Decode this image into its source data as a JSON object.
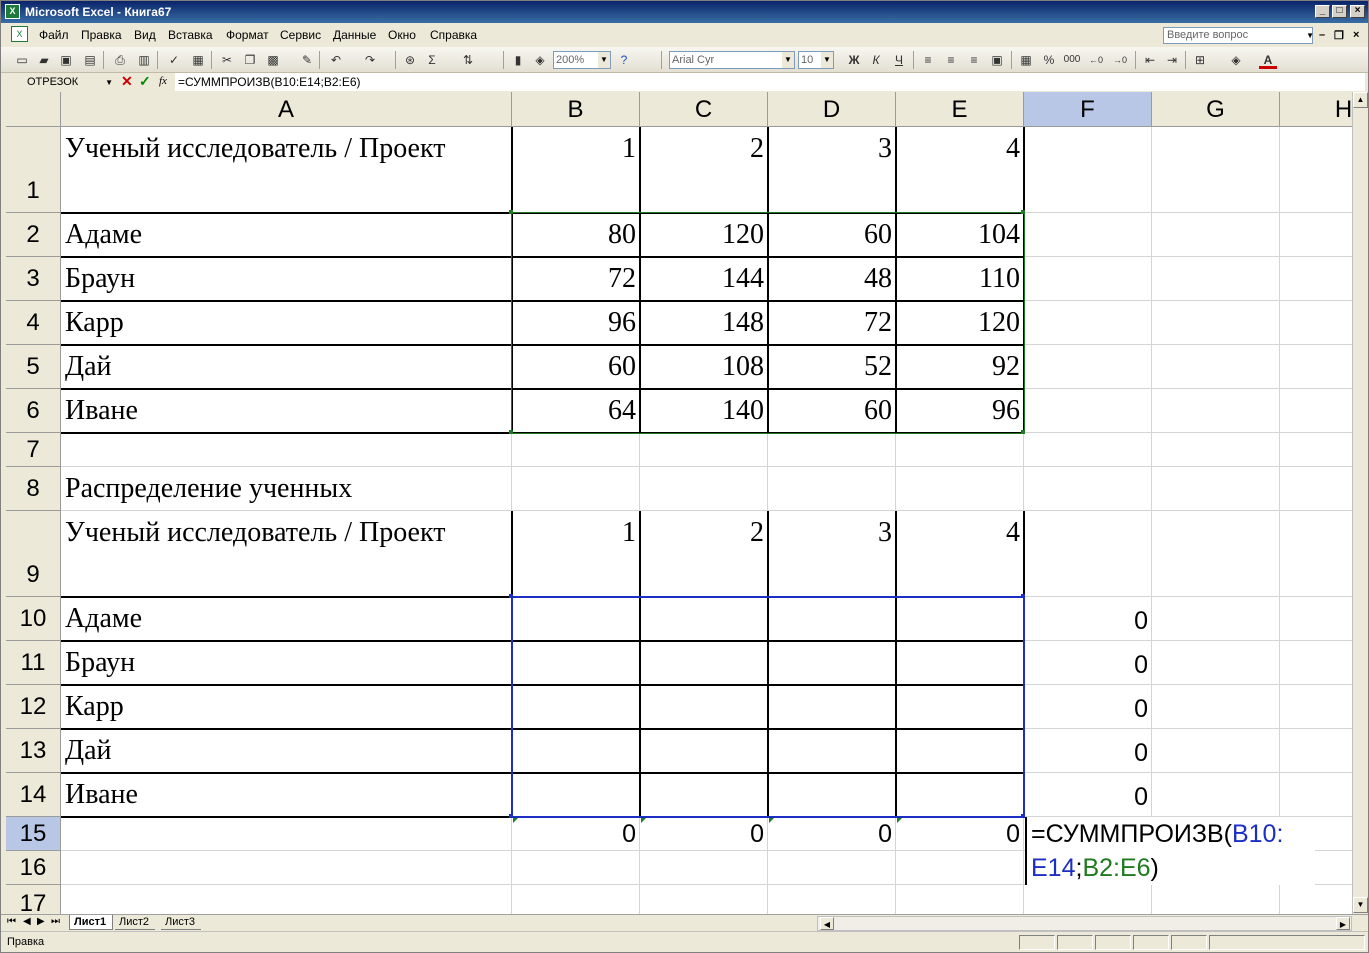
{
  "window": {
    "title": "Microsoft Excel - Книга67",
    "minimize_glyph": "_",
    "maximize_glyph": "□",
    "close_glyph": "×"
  },
  "menu": {
    "items": [
      "Файл",
      "Правка",
      "Вид",
      "Вставка",
      "Формат",
      "Сервис",
      "Данные",
      "Окно",
      "Справка"
    ],
    "help_placeholder": "Введите вопрос",
    "doc_minimize_glyph": "–",
    "doc_restore_glyph": "❐",
    "doc_close_glyph": "×"
  },
  "toolbar": {
    "zoom": "200%",
    "font_name": "Arial Cyr",
    "font_size": "10",
    "bold_label": "Ж",
    "italic_label": "К",
    "underline_label": "Ч",
    "percent_label": "%",
    "thousands_label": "000",
    "autosum_label": "Σ",
    "icons": [
      "new-icon",
      "open-icon",
      "save-icon",
      "permission-icon",
      "print-icon",
      "print-preview-icon",
      "spelling-icon",
      "research-icon",
      "cut-icon",
      "copy-icon",
      "paste-icon",
      "format-painter-icon",
      "undo-icon",
      "redo-icon",
      "hyperlink-icon",
      "autosum-icon",
      "sort-icon",
      "chart-wizard-icon",
      "drawing-icon",
      "help-icon"
    ]
  },
  "formula_bar": {
    "name_box": "ОТРЕЗОК",
    "cancel_glyph": "✕",
    "enter_glyph": "✓",
    "fx_label": "fx",
    "formula": "=СУММПРОИЗВ(B10:E14;B2:E6)"
  },
  "columns": [
    "A",
    "B",
    "C",
    "D",
    "E",
    "F",
    "G",
    "H"
  ],
  "rows": [
    "1",
    "2",
    "3",
    "4",
    "5",
    "6",
    "7",
    "8",
    "9",
    "10",
    "11",
    "12",
    "13",
    "14",
    "15",
    "16",
    "17"
  ],
  "table1": {
    "header": "Ученый исследователь / Проект",
    "projects": [
      "1",
      "2",
      "3",
      "4"
    ],
    "names": [
      "Адаме",
      "Браун",
      "Карр",
      "Дай",
      "Иване"
    ],
    "values": [
      [
        "80",
        "120",
        "60",
        "104"
      ],
      [
        "72",
        "144",
        "48",
        "110"
      ],
      [
        "96",
        "148",
        "72",
        "120"
      ],
      [
        "60",
        "108",
        "52",
        "92"
      ],
      [
        "64",
        "140",
        "60",
        "96"
      ]
    ]
  },
  "section_title": "Распределение ученных",
  "table2": {
    "header": "Ученый исследователь / Проект",
    "projects": [
      "1",
      "2",
      "3",
      "4"
    ],
    "names": [
      "Адаме",
      "Браун",
      "Карр",
      "Дай",
      "Иване"
    ],
    "row_sums": [
      "0",
      "0",
      "0",
      "0",
      "0"
    ],
    "col_sums": [
      "0",
      "0",
      "0",
      "0"
    ]
  },
  "edit_cell": {
    "prefix": "=СУММПРОИЗВ(",
    "range1": "B10:",
    "range1b": "E14",
    "sep": ";",
    "range2": "B2:E6",
    "suffix": ")",
    "range1_color": "#1c2fc2",
    "range2_color": "#1e7a1e"
  },
  "sheets": [
    "Лист1",
    "Лист2",
    "Лист3"
  ],
  "status": "Правка"
}
